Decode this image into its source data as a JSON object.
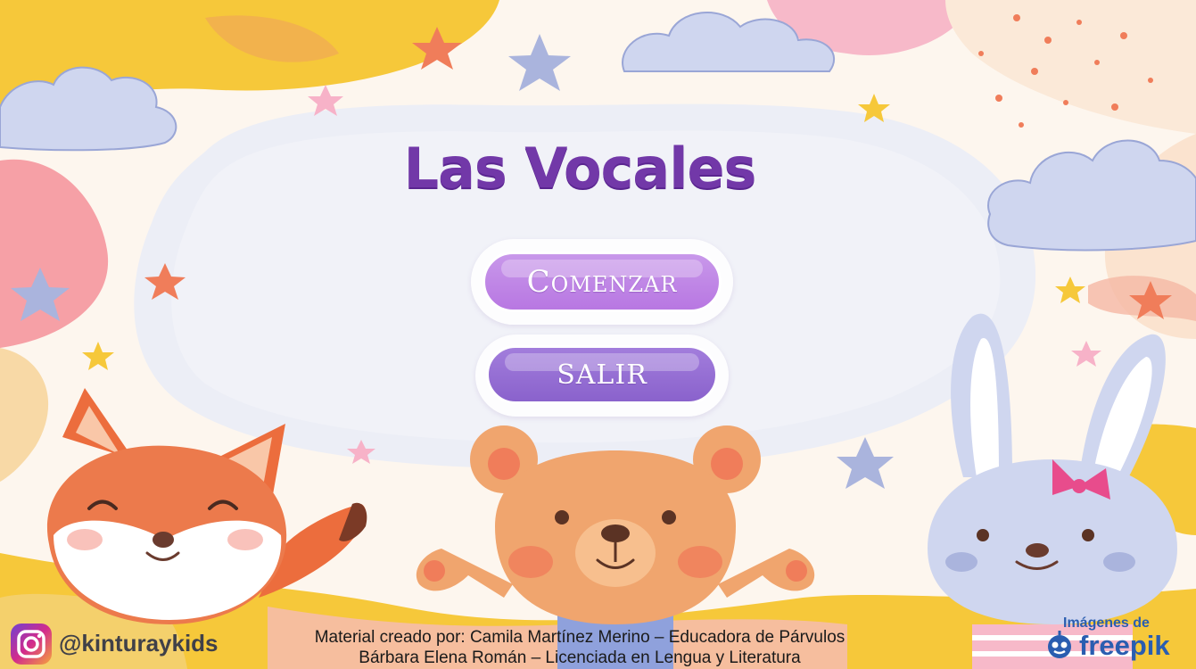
{
  "title": "Las Vocales",
  "menu": {
    "start_label": "Comenzar",
    "exit_label": "SALIR"
  },
  "social": {
    "icon": "instagram-icon",
    "handle": "@kinturaykids"
  },
  "credits": {
    "line1": "Material creado por: Camila Martínez Merino – Educadora de Párvulos",
    "line2": "Bárbara Elena Román – Licenciada en Lengua y Literatura"
  },
  "attribution": {
    "caption": "Imágenes de",
    "brand": "freepik",
    "icon": "freepik-logo-icon"
  },
  "characters": [
    "fox",
    "bear",
    "bunny"
  ],
  "colors": {
    "title": "#7238a8",
    "start_button": "#c08ae6",
    "exit_button": "#9470d4",
    "freepik_blue": "#2a5db0"
  }
}
